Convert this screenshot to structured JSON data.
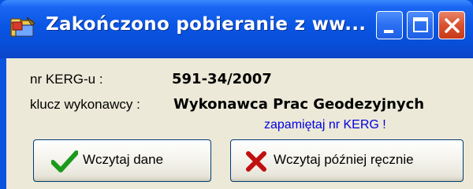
{
  "window": {
    "title": "Zakończono pobieranie z ww..."
  },
  "fields": {
    "kerg_label": "nr KERG-u :",
    "kerg_value": "591-34/2007",
    "contractor_label": "klucz wykonawcy :",
    "contractor_value": "Wykonawca Prac Geodezyjnych"
  },
  "link": {
    "remember_kerg": "zapamiętaj nr KERG !"
  },
  "buttons": {
    "load_label": "Wczytaj dane",
    "load_icon": "checkmark-icon",
    "later_label": "Wczytaj później ręcznie",
    "later_icon": "x-icon"
  },
  "colors": {
    "titlebar": "#0a55e4",
    "client_bg": "#ece9d8",
    "link": "#0000e0",
    "check_green": "#1a9a1a",
    "cross_red": "#c01010",
    "close_button": "#d9512f"
  }
}
